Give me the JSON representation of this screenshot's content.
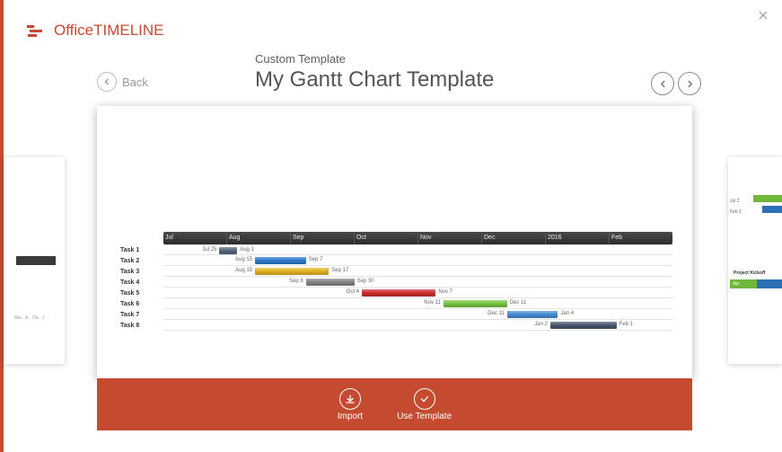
{
  "app": {
    "name_part1": "Office",
    "name_part2": "TIMELINE"
  },
  "close_label": "×",
  "back": {
    "label": "Back"
  },
  "title_block": {
    "subtitle": "Custom Template",
    "title": "My Gantt Chart Template"
  },
  "chart_data": {
    "type": "gantt",
    "months": [
      "Jul",
      "Aug",
      "Sep",
      "Oct",
      "Nov",
      "Dec",
      "2016",
      "Feb"
    ],
    "tasks": [
      {
        "name": "Task 1",
        "start_label": "Jul 25",
        "end_label": "Aug 1",
        "start_pct": 11,
        "width_pct": 3.5,
        "color": "#5a6a80"
      },
      {
        "name": "Task 2",
        "start_label": "Aug 15",
        "end_label": "Sep 7",
        "start_pct": 18,
        "width_pct": 10,
        "color": "#2d7dd2"
      },
      {
        "name": "Task 3",
        "start_label": "Aug 15",
        "end_label": "Sep 17",
        "start_pct": 18,
        "width_pct": 14.5,
        "color": "#e8b923"
      },
      {
        "name": "Task 4",
        "start_label": "Sep 8",
        "end_label": "Sep 30",
        "start_pct": 28,
        "width_pct": 9.5,
        "color": "#888888"
      },
      {
        "name": "Task 5",
        "start_label": "Oct 4",
        "end_label": "Nov 7",
        "start_pct": 39,
        "width_pct": 14.5,
        "color": "#d32f2f"
      },
      {
        "name": "Task 6",
        "start_label": "Nov 11",
        "end_label": "Dec 11",
        "start_pct": 55,
        "width_pct": 12.5,
        "color": "#7ac943"
      },
      {
        "name": "Task 7",
        "start_label": "Dec 11",
        "end_label": "Jan 4",
        "start_pct": 67.5,
        "width_pct": 10,
        "color": "#4a90d9"
      },
      {
        "name": "Task 8",
        "start_label": "Jan 2",
        "end_label": "Feb 1",
        "start_pct": 76,
        "width_pct": 13,
        "color": "#4a5a70"
      }
    ]
  },
  "actions": {
    "import": "Import",
    "use_template": "Use Template"
  },
  "left_peek": {
    "frag_text": "Ma…A…Da…I"
  },
  "right_peek": {
    "label1": "Jul 2",
    "label2": "Feb 1",
    "project_label": "Project Kickoff",
    "tick": "Apr"
  }
}
